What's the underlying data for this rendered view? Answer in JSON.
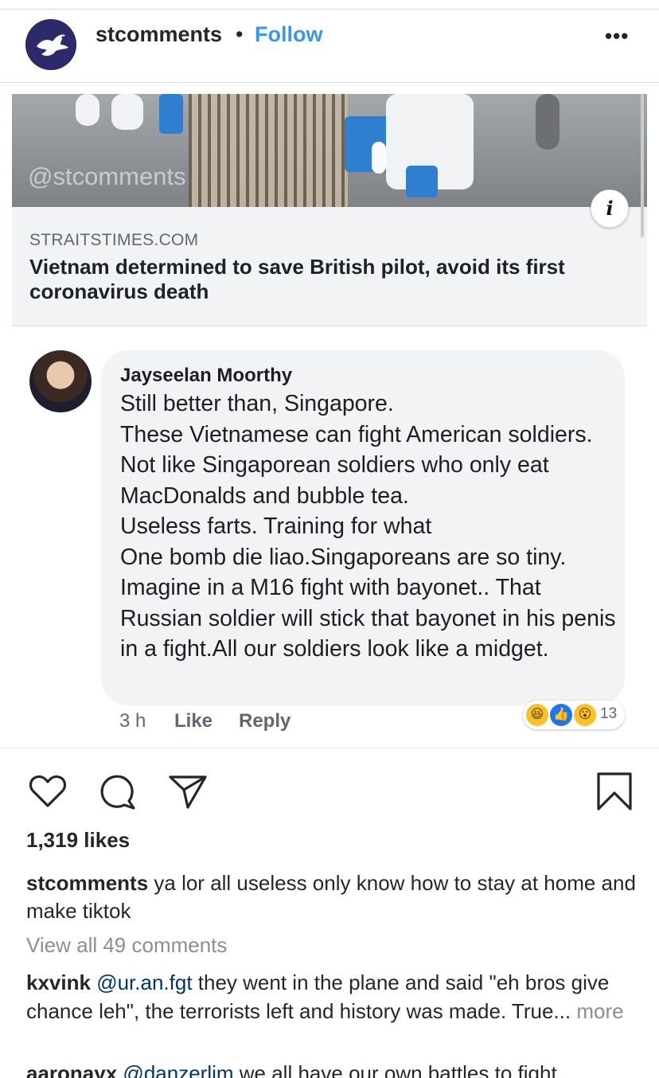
{
  "header": {
    "username": "stcomments",
    "separator": "•",
    "follow_label": "Follow",
    "more_label": "•••"
  },
  "link_card": {
    "watermark": "@stcomments",
    "domain": "STRAITSTIMES.COM",
    "headline": "Vietnam determined to save British pilot, avoid its first coronavirus death",
    "info_label": "i"
  },
  "fb_comment": {
    "author": "Jayseelan Moorthy",
    "text": "Still better than, Singapore.\nThese Vietnamese can fight American soldiers. Not like Singaporean soldiers who only eat MacDonalds and bubble tea.\nUseless farts. Training for what\nOne bomb die liao.Singaporeans are so tiny. Imagine in a M16 fight with bayonet.. That Russian soldier will stick that bayonet in his penis in a fight.All our soldiers look like a midget.",
    "time": "3 h",
    "like_label": "Like",
    "reply_label": "Reply",
    "reaction_count": "13",
    "reactions": [
      "haha-icon",
      "like-icon",
      "wow-icon"
    ]
  },
  "actions": {
    "icons": [
      "heart-icon",
      "comment-icon",
      "share-icon",
      "bookmark-icon"
    ]
  },
  "likes": "1,319 likes",
  "caption": {
    "username": "stcomments",
    "text": "ya lor all useless only know how to stay at home and make tiktok"
  },
  "view_all": "View all 49 comments",
  "comments": [
    {
      "username": "kxvink",
      "mention": "@ur.an.fgt",
      "text": "they went in the plane and said \"eh bros give chance leh\", the terrorists left and history was made. True...",
      "more": "more"
    },
    {
      "username": "aaronayx",
      "mention": "@danzerlim",
      "text": "we all have our own battles to fight."
    }
  ],
  "colors": {
    "follow": "#3897f0",
    "mention": "#003569",
    "muted": "#8e8e8e",
    "fb_bubble": "#f2f3f5"
  }
}
